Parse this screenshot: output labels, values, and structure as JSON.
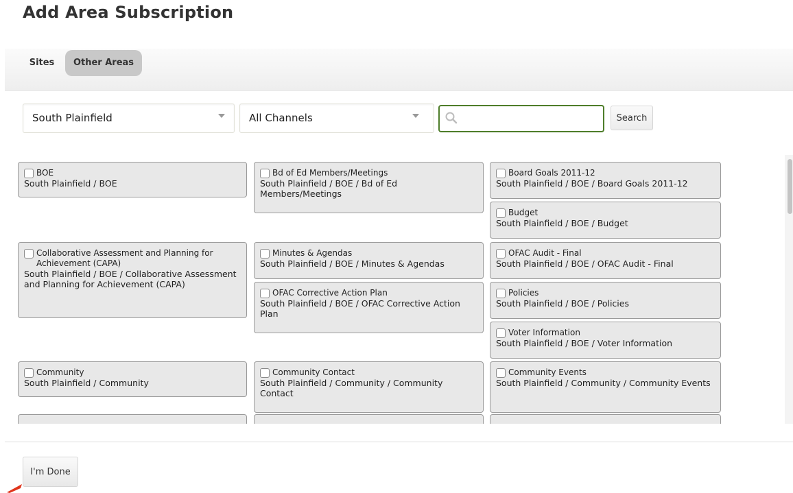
{
  "page": {
    "title": "Add Area Subscription"
  },
  "tabs": [
    {
      "label": "Sites",
      "active": false
    },
    {
      "label": "Other Areas",
      "active": true
    }
  ],
  "filters": {
    "location": "South Plainfield",
    "channel": "All Channels",
    "search_value": "",
    "search_button": "Search"
  },
  "areas": [
    {
      "name": "BOE",
      "path": "South Plainfield / BOE"
    },
    {
      "name": "Bd of Ed Members/Meetings",
      "path": "South Plainfield / BOE / Bd of Ed Members/Meetings"
    },
    {
      "name": "Board Goals 2011-12",
      "path": "South Plainfield / BOE / Board Goals 2011-12"
    },
    {
      "name": "Budget",
      "path": "South Plainfield / BOE / Budget"
    },
    {
      "name": "Collaborative Assessment and Planning for Achievement (CAPA)",
      "path": "South Plainfield / BOE / Collaborative Assessment and Planning for Achievement (CAPA)"
    },
    {
      "name": "Minutes & Agendas",
      "path": "South Plainfield / BOE / Minutes & Agendas"
    },
    {
      "name": "OFAC Audit - Final",
      "path": "South Plainfield / BOE / OFAC Audit - Final"
    },
    {
      "name": "OFAC Corrective Action Plan",
      "path": "South Plainfield / BOE / OFAC Corrective Action Plan"
    },
    {
      "name": "Policies",
      "path": "South Plainfield / BOE / Policies"
    },
    {
      "name": "Voter Information",
      "path": "South Plainfield / BOE / Voter Information"
    },
    {
      "name": "Community",
      "path": "South Plainfield / Community"
    },
    {
      "name": "Community Contact",
      "path": "South Plainfield / Community / Community Contact"
    },
    {
      "name": "Community Events",
      "path": "South Plainfield / Community / Community Events"
    }
  ],
  "footer": {
    "done_label": "I'm Done"
  },
  "colors": {
    "search_border": "#4e7d2a",
    "card_bg": "#e8e8e8",
    "active_tab_bg": "#c8c8c8"
  }
}
